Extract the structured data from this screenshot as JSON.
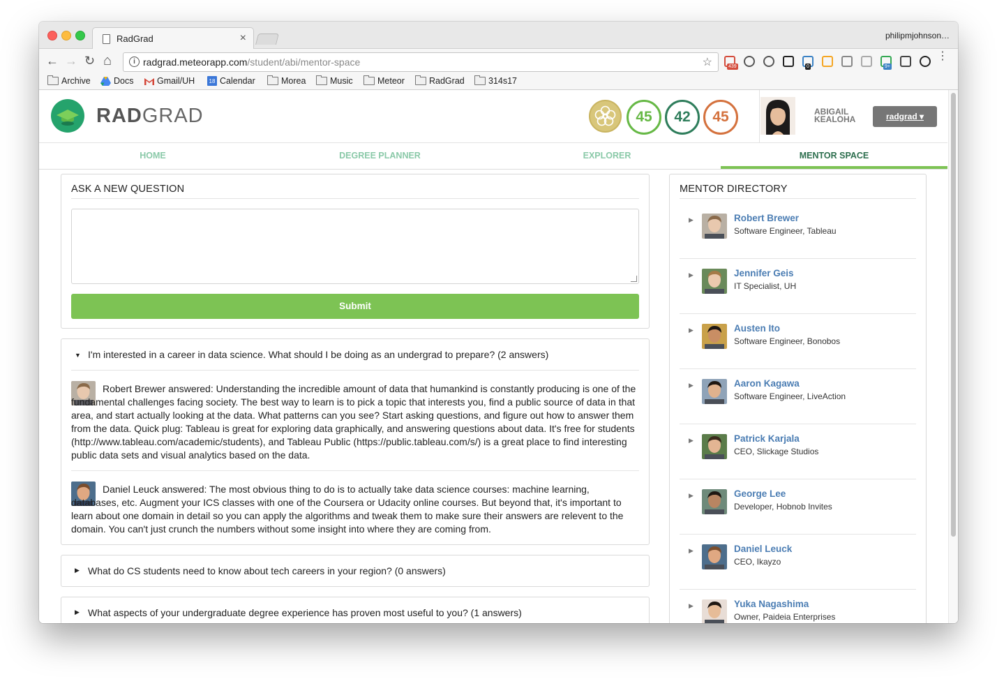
{
  "browser": {
    "tab_title": "RadGrad",
    "tab_close": "×",
    "profile_name": "philipmjohnson…",
    "url_host": "radgrad.meteorapp.com",
    "url_path": "/student/abi/mentor-space",
    "nav_back": "←",
    "nav_forward": "→",
    "nav_reload": "↻",
    "nav_home": "⌂",
    "star": "☆",
    "menu": "⋮",
    "extensions": [
      {
        "icon": "mail-extension-icon",
        "badge": "439",
        "color": "#d44c3c"
      },
      {
        "icon": "clock-extension-icon",
        "color": "#555555"
      },
      {
        "icon": "info-extension-icon",
        "color": "#555555"
      },
      {
        "icon": "jb-extension-icon",
        "color": "#222222"
      },
      {
        "icon": "rocket-extension-icon",
        "badge": "0",
        "color": "#3b82c4"
      },
      {
        "icon": "chart-extension-icon",
        "color": "#f5a623"
      },
      {
        "icon": "camera-extension-icon",
        "color": "#888888"
      },
      {
        "icon": "cloud-extension-icon",
        "color": "#aaaaaa"
      },
      {
        "icon": "user-extension-icon",
        "badge": "9+",
        "color": "#34a853"
      },
      {
        "icon": "eyedropper-extension-icon",
        "color": "#444444"
      },
      {
        "icon": "color-wheel-extension-icon",
        "color": "#222222"
      }
    ]
  },
  "bookmarks": [
    {
      "label": "Archive",
      "icon": "folder-icon"
    },
    {
      "label": "Docs",
      "icon": "drive-icon"
    },
    {
      "label": "Gmail/UH",
      "icon": "gmail-icon"
    },
    {
      "label": "Calendar",
      "icon": "calendar-icon",
      "badge": "18"
    },
    {
      "label": "Morea",
      "icon": "folder-icon"
    },
    {
      "label": "Music",
      "icon": "folder-icon"
    },
    {
      "label": "Meteor",
      "icon": "folder-icon"
    },
    {
      "label": "RadGrad",
      "icon": "folder-icon"
    },
    {
      "label": "314s17",
      "icon": "folder-icon"
    }
  ],
  "header": {
    "logo_a": "RAD",
    "logo_b": "GRAD",
    "scores": [
      {
        "value": "45",
        "color": "#66b845"
      },
      {
        "value": "42",
        "color": "#2e7d5b"
      },
      {
        "value": "45",
        "color": "#d4713d"
      }
    ],
    "user_first": "ABIGAIL",
    "user_last": "KEALOHA",
    "user_button": "radgrad ▾"
  },
  "menu": {
    "items": [
      {
        "label": "HOME"
      },
      {
        "label": "DEGREE PLANNER"
      },
      {
        "label": "EXPLORER"
      },
      {
        "label": "MENTOR SPACE",
        "active": true
      }
    ]
  },
  "ask": {
    "title": "ASK A NEW QUESTION",
    "placeholder": "",
    "submit": "Submit"
  },
  "questions": [
    {
      "caret": "▼",
      "text": "I'm interested in a career in data science. What should I be doing as an undergrad to prepare? (2 answers)",
      "answers": [
        {
          "author": "Robert Brewer",
          "text": "Robert Brewer answered: Understanding the incredible amount of data that humankind is constantly producing is one of the fundamental challenges facing society. The best way to learn is to pick a topic that interests you, find a public source of data in that area, and start actually looking at the data. What patterns can you see? Start asking questions, and figure out how to answer them from the data. Quick plug: Tableau is great for exploring data graphically, and answering questions about data. It's free for students (http://www.tableau.com/academic/students), and Tableau Public (https://public.tableau.com/s/) is a great place to find interesting public data sets and visual analytics based on the data."
        },
        {
          "author": "Daniel Leuck",
          "text": "Daniel Leuck answered: The most obvious thing to do is to actually take data science courses: machine learning, databases, etc. Augment your ICS classes with one of the Coursera or Udacity online courses. But beyond that, it's important to learn about one domain in detail so you can apply the algorithms and tweak them to make sure their answers are relevent to the domain. You can't just crunch the numbers without some insight into where they are coming from."
        }
      ]
    },
    {
      "caret": "▶",
      "text": "What do CS students need to know about tech careers in your region? (0 answers)"
    },
    {
      "caret": "▶",
      "text": "What aspects of your undergraduate degree experience has proven most useful to you? (1 answers)"
    }
  ],
  "directory": {
    "title": "MENTOR DIRECTORY",
    "mentors": [
      {
        "name": "Robert Brewer",
        "role": "Software Engineer, Tableau"
      },
      {
        "name": "Jennifer Geis",
        "role": "IT Specialist, UH"
      },
      {
        "name": "Austen Ito",
        "role": "Software Engineer, Bonobos"
      },
      {
        "name": "Aaron Kagawa",
        "role": "Software Engineer, LiveAction"
      },
      {
        "name": "Patrick Karjala",
        "role": "CEO, Slickage Studios"
      },
      {
        "name": "George Lee",
        "role": "Developer, Hobnob Invites"
      },
      {
        "name": "Daniel Leuck",
        "role": "CEO, Ikayzo"
      },
      {
        "name": "Yuka Nagashima",
        "role": "Owner, Paideia Enterprises"
      }
    ]
  },
  "colors": {
    "brand_green": "#25a36c",
    "accent_green": "#7dc354",
    "menu_inactive": "#8ac9a8",
    "menu_active": "#2c6e4d",
    "link_blue": "#4b7db3"
  }
}
